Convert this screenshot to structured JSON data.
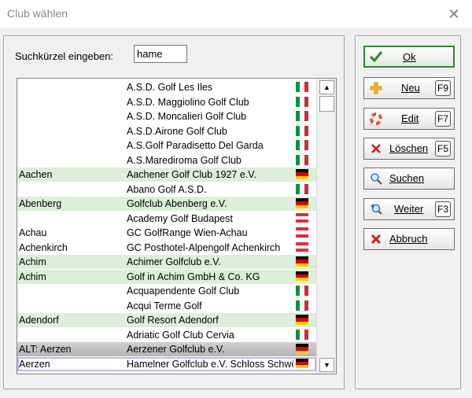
{
  "window": {
    "title": "Club wählen",
    "close_glyph": "✕"
  },
  "search": {
    "label": "Suchkürzel eingeben:",
    "value": "hame"
  },
  "list": {
    "rows": [
      {
        "short": "",
        "club": "A.S.D. Golf Les Iles",
        "flag": "it",
        "bg": "white"
      },
      {
        "short": "",
        "club": "A.S.D. Maggiolino Golf Club",
        "flag": "it",
        "bg": "white"
      },
      {
        "short": "",
        "club": "A.S.D. Moncalieri Golf Club",
        "flag": "it",
        "bg": "white"
      },
      {
        "short": "",
        "club": "A.S.D.Airone Golf Club",
        "flag": "it",
        "bg": "white"
      },
      {
        "short": "",
        "club": "A.S.Golf Paradisetto Del Garda",
        "flag": "it",
        "bg": "white"
      },
      {
        "short": "",
        "club": "A.S.Marediroma Golf Club",
        "flag": "it",
        "bg": "white"
      },
      {
        "short": "Aachen",
        "club": "Aachener Golf Club 1927 e.V.",
        "flag": "de",
        "bg": "green"
      },
      {
        "short": "",
        "club": "Abano Golf A.S.D.",
        "flag": "it",
        "bg": "white"
      },
      {
        "short": "Abenberg",
        "club": "Golfclub Abenberg e.V.",
        "flag": "de",
        "bg": "green"
      },
      {
        "short": "",
        "club": "Academy Golf Budapest",
        "flag": "at",
        "bg": "white"
      },
      {
        "short": "Achau",
        "club": "GC GolfRange Wien-Achau",
        "flag": "at",
        "bg": "white"
      },
      {
        "short": "Achenkirch",
        "club": "GC Posthotel-Alpengolf Achenkirch",
        "flag": "at",
        "bg": "white"
      },
      {
        "short": "Achim",
        "club": "Achimer Golfclub e.V.",
        "flag": "de",
        "bg": "green"
      },
      {
        "short": "Achim",
        "club": "Golf in Achim GmbH & Co. KG",
        "flag": "de",
        "bg": "green"
      },
      {
        "short": "",
        "club": "Acquapendente Golf Club",
        "flag": "it",
        "bg": "white"
      },
      {
        "short": "",
        "club": "Acqui Terme Golf",
        "flag": "it",
        "bg": "white"
      },
      {
        "short": "Adendorf",
        "club": "Golf Resort Adendorf",
        "flag": "de",
        "bg": "green"
      },
      {
        "short": "",
        "club": "Adriatic Golf Club Cervia",
        "flag": "it",
        "bg": "white"
      },
      {
        "short": "ALT: Aerzen",
        "club": "Aerzener Golfclub e.V.",
        "flag": "de",
        "bg": "gray"
      },
      {
        "short": "Aerzen",
        "club": "Hamelner Golfclub e.V. Schloss Schwöbber",
        "flag": "de",
        "bg": "selected"
      }
    ],
    "scroll_up_glyph": "▲",
    "scroll_down_glyph": "▼"
  },
  "buttons": {
    "ok": {
      "label": "Ok",
      "icon": "checkmark-icon"
    },
    "new": {
      "label": "Neu",
      "key": "F9",
      "icon": "plus-icon"
    },
    "edit": {
      "label": "Edit",
      "key": "F7",
      "icon": "lifebuoy-icon"
    },
    "delete": {
      "label": "Löschen",
      "key": "F5",
      "icon": "red-x-icon"
    },
    "search": {
      "label": "Suchen",
      "icon": "magnifier-icon"
    },
    "next": {
      "label": "Weiter",
      "key": "F3",
      "icon": "magnifier-arrow-icon"
    },
    "cancel": {
      "label": "Abbruch",
      "icon": "cancel-x-icon"
    }
  },
  "colors": {
    "row_green": "#dcefd9",
    "row_gray": "#c4c4c4",
    "ok_border": "#2d8a2d",
    "flag_it": [
      "#009246",
      "#ffffff",
      "#ce2b37"
    ],
    "flag_de": [
      "#000000",
      "#dd0000",
      "#ffce00"
    ],
    "flag_at": [
      "#ed2939",
      "#ffffff",
      "#ed2939"
    ]
  }
}
